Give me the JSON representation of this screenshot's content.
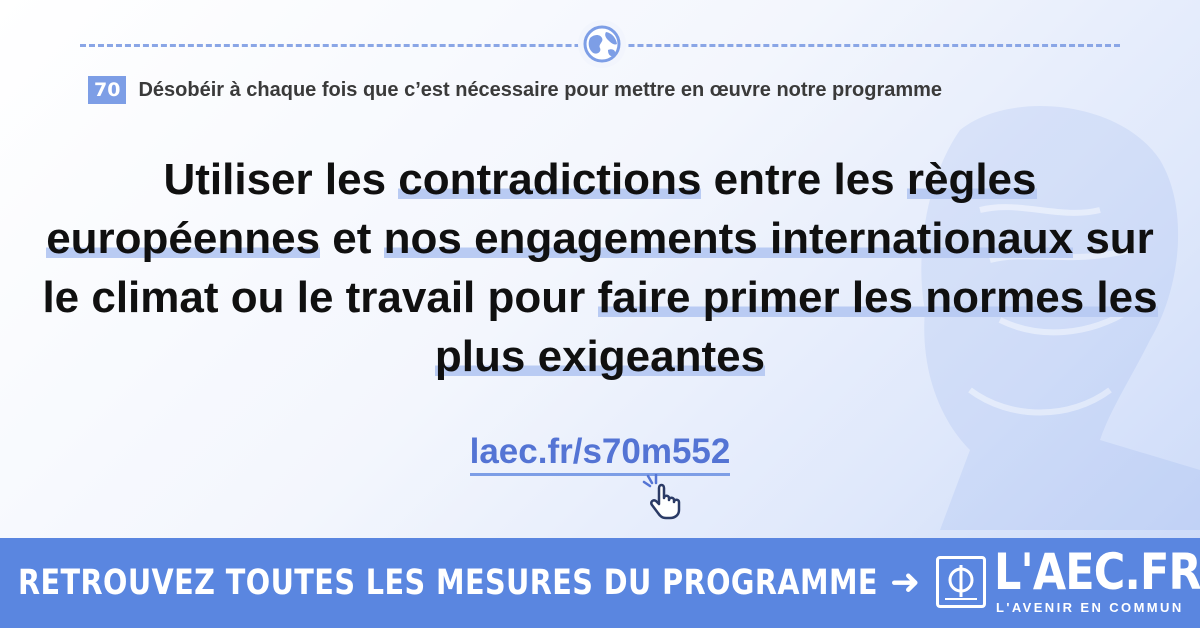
{
  "header": {
    "number": "70",
    "subtitle": "Désobéir à chaque fois que c’est nécessaire pour mettre en œuvre notre programme"
  },
  "headline": {
    "segments": [
      {
        "text": "Utiliser les ",
        "highlight": false
      },
      {
        "text": "contradictions",
        "highlight": true
      },
      {
        "text": " entre les ",
        "highlight": false
      },
      {
        "text": "règles européennes",
        "highlight": true
      },
      {
        "text": " et ",
        "highlight": false
      },
      {
        "text": "nos engagements internationaux",
        "highlight": true
      },
      {
        "text": " sur le climat ou le travail pour ",
        "highlight": false
      },
      {
        "text": "faire primer les normes les plus exigeantes",
        "highlight": true
      }
    ]
  },
  "link": {
    "label": "laec.fr/s70m552"
  },
  "banner": {
    "text": "RETROUVEZ TOUTES LES MESURES DU PROGRAMME",
    "arrow": "➜",
    "logo_text": "L'AEC.FR",
    "logo_tagline": "L'AVENIR EN COMMUN"
  },
  "icons": {
    "top": "globe-icon",
    "cursor": "pointer-hand-icon",
    "logo": "phi-logo-icon"
  },
  "colors": {
    "accent": "#5a86e0",
    "highlight": "#b9cbf3",
    "link": "#5474d4",
    "badge": "#7d9ee6"
  }
}
